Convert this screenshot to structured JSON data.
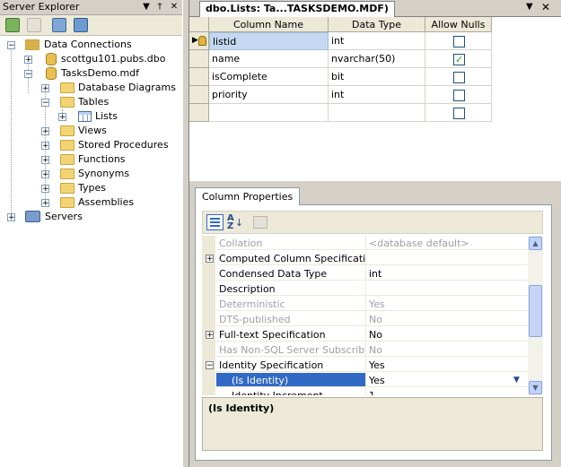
{
  "server_explorer": {
    "title": "Server Explorer",
    "pin_glyph": "▼",
    "autohide_glyph": "†",
    "close_glyph": "✕",
    "tree": {
      "data_connections": "Data Connections",
      "conn1": "scottgu101.pubs.dbo",
      "conn2": "TasksDemo.mdf",
      "database_diagrams": "Database Diagrams",
      "tables": "Tables",
      "lists": "Lists",
      "views": "Views",
      "stored_procedures": "Stored Procedures",
      "functions": "Functions",
      "synonyms": "Synonyms",
      "types": "Types",
      "assemblies": "Assemblies",
      "servers": "Servers"
    }
  },
  "document": {
    "tab_title": "dbo.Lists: Ta...TASKSDEMO.MDF)",
    "dropdown_glyph": "▼",
    "close_glyph": "✕",
    "grid": {
      "headers": {
        "column_name": "Column Name",
        "data_type": "Data Type",
        "allow_nulls": "Allow Nulls"
      },
      "rows": [
        {
          "name": "listid",
          "type": "int",
          "nulls": false,
          "key": true
        },
        {
          "name": "name",
          "type": "nvarchar(50)",
          "nulls": true
        },
        {
          "name": "isComplete",
          "type": "bit",
          "nulls": false
        },
        {
          "name": "priority",
          "type": "int",
          "nulls": false
        },
        {
          "name": "",
          "type": "",
          "nulls": false
        }
      ]
    }
  },
  "column_properties": {
    "tab": "Column Properties",
    "props": [
      {
        "name": "Collation",
        "value": "<database default>",
        "disabled": true
      },
      {
        "name": "Computed Column Specification",
        "value": "",
        "expand": "+"
      },
      {
        "name": "Condensed Data Type",
        "value": "int"
      },
      {
        "name": "Description",
        "value": ""
      },
      {
        "name": "Deterministic",
        "value": "Yes",
        "disabled": true
      },
      {
        "name": "DTS-published",
        "value": "No",
        "disabled": true
      },
      {
        "name": "Full-text Specification",
        "value": "No",
        "expand": "+"
      },
      {
        "name": "Has Non-SQL Server Subscriber",
        "value": "No",
        "disabled": true
      },
      {
        "name": "Identity Specification",
        "value": "Yes",
        "expand": "−"
      },
      {
        "name": "(Is Identity)",
        "value": "Yes",
        "selected": true,
        "indent": true
      },
      {
        "name": "Identity Increment",
        "value": "1",
        "indent": true
      }
    ],
    "description_title": "(Is Identity)",
    "scroll_up_glyph": "▲",
    "scroll_down_glyph": "▼",
    "value_dropdown_glyph": "▼"
  }
}
